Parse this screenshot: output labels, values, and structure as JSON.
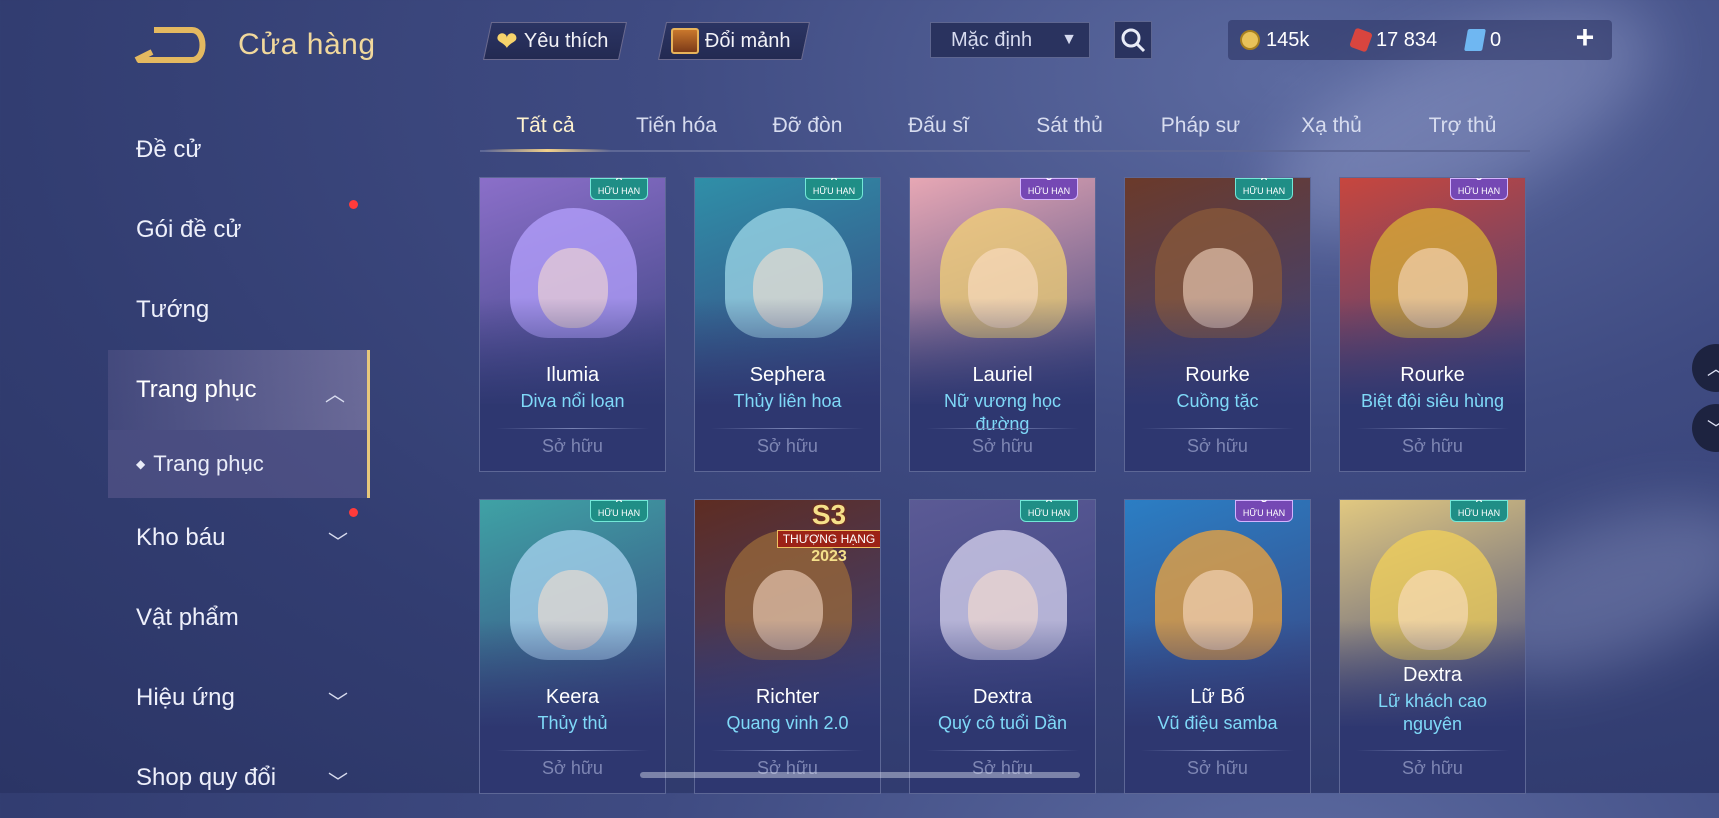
{
  "header": {
    "title": "Cửa hàng",
    "favorite_label": "Yêu thích",
    "exchange_label": "Đổi mảnh",
    "sort_value": "Mặc định"
  },
  "currency": {
    "gold": "145k",
    "gems": "17 834",
    "tickets": "0",
    "gold_color": "#e8c25a",
    "gem_color": "#d8453f",
    "ticket_color": "#6fb7f2"
  },
  "sidebar": {
    "items": [
      {
        "label": "Đề cử"
      },
      {
        "label": "Gói đề cử"
      },
      {
        "label": "Tướng"
      },
      {
        "label": "Trang phục"
      },
      {
        "label": "Kho báu"
      },
      {
        "label": "Vật phẩm"
      },
      {
        "label": "Hiệu ứng"
      },
      {
        "label": "Shop quy đổi"
      }
    ],
    "sub_item": "Trang phục"
  },
  "tabs": [
    "Tất cả",
    "Tiến hóa",
    "Đỡ đòn",
    "Đấu sĩ",
    "Sát thủ",
    "Pháp sư",
    "Xạ thủ",
    "Trợ thủ"
  ],
  "badge_text": "HỮU HẠN",
  "season_badge": {
    "season": "S3",
    "ribbon": "THƯỢNG HẠNG",
    "year": "2023"
  },
  "cards": [
    {
      "hero": "Ilumia",
      "skin": "Diva nổi loạn",
      "status": "Sở hữu",
      "rank": "A",
      "tone": "#8b6fc9",
      "hair": "#b6a1ff"
    },
    {
      "hero": "Sephera",
      "skin": "Thủy liên hoa",
      "status": "Sở hữu",
      "rank": "A",
      "tone": "#2f8fa8",
      "hair": "#9fd8e8"
    },
    {
      "hero": "Lauriel",
      "skin": "Nữ vương học đường",
      "status": "Sở hữu",
      "rank": "S",
      "tone": "#e7a7b4",
      "hair": "#f1d276"
    },
    {
      "hero": "Rourke",
      "skin": "Cuồng tặc",
      "status": "Sở hữu",
      "rank": "A",
      "tone": "#6b3a2a",
      "hair": "#8a5a3a"
    },
    {
      "hero": "Rourke",
      "skin": "Biệt đội siêu hùng",
      "status": "Sở hữu",
      "rank": "S",
      "tone": "#c7463e",
      "hair": "#d8b035"
    },
    {
      "hero": "Keera",
      "skin": "Thủy thủ",
      "status": "Sở hữu",
      "rank": "A",
      "tone": "#3fa2a5",
      "hair": "#a9d4f0"
    },
    {
      "hero": "Richter",
      "skin": "Quang vinh 2.0",
      "status": "Sở hữu",
      "rank": "",
      "tone": "#5e2c22",
      "hair": "#9a6a3a"
    },
    {
      "hero": "Dextra",
      "skin": "Quý cô tuổi Dần",
      "status": "Sở hữu",
      "rank": "A",
      "tone": "#5b5a95",
      "hair": "#d8d4ef"
    },
    {
      "hero": "Lữ Bố",
      "skin": "Vũ điệu samba",
      "status": "Sở hữu",
      "rank": "S",
      "tone": "#2b7ec4",
      "hair": "#f2a43a"
    },
    {
      "hero": "Dextra",
      "skin": "Lữ khách cao nguyên",
      "status": "Sở hữu",
      "rank": "A",
      "tone": "#e1c880",
      "hair": "#f1d05a"
    }
  ]
}
